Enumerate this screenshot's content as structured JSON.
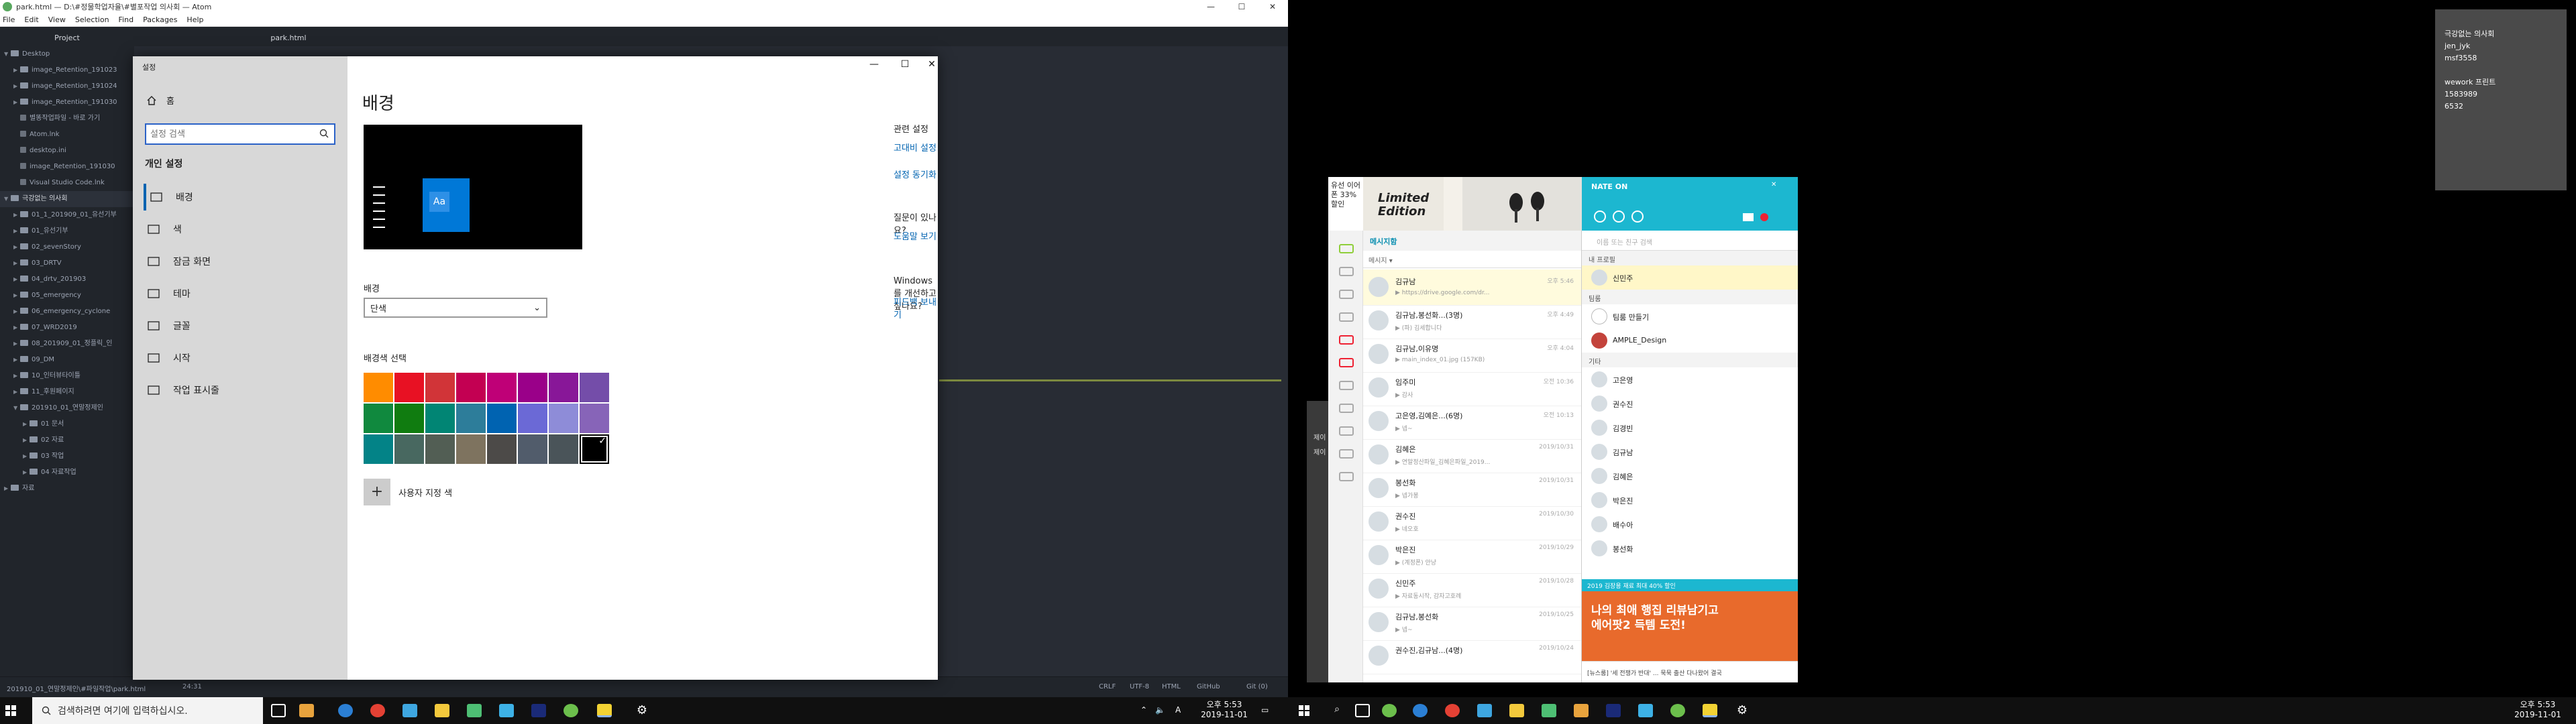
{
  "atom": {
    "window_title": "park.html — D:\\#정물학업자율\\#별포작업 의사회 — Atom",
    "menu": [
      "File",
      "Edit",
      "View",
      "Selection",
      "Find",
      "Packages",
      "Help"
    ],
    "tabs": {
      "project": "Project",
      "file": "park.html"
    },
    "tree": [
      {
        "label": "Desktop",
        "type": "folder",
        "indent": 0,
        "open": true
      },
      {
        "label": "image_Retention_191023",
        "type": "folder",
        "indent": 1
      },
      {
        "label": "image_Retention_191024",
        "type": "folder",
        "indent": 1
      },
      {
        "label": "image_Retention_191030",
        "type": "folder",
        "indent": 1
      },
      {
        "label": "별똥작업파일 - 바로 가기",
        "type": "file",
        "indent": 1
      },
      {
        "label": "Atom.lnk",
        "type": "file",
        "indent": 1
      },
      {
        "label": "desktop.ini",
        "type": "file",
        "indent": 1
      },
      {
        "label": "image_Retention_191030",
        "type": "file",
        "indent": 1
      },
      {
        "label": "Visual Studio Code.lnk",
        "type": "file",
        "indent": 1
      },
      {
        "label": "극강없는 의사회",
        "type": "folder",
        "indent": 0,
        "open": true,
        "selected": true
      },
      {
        "label": "01_1_201909_01_유선기부",
        "type": "folder",
        "indent": 1
      },
      {
        "label": "01_유선기부",
        "type": "folder",
        "indent": 1
      },
      {
        "label": "02_sevenStory",
        "type": "folder",
        "indent": 1
      },
      {
        "label": "03_DRTV",
        "type": "folder",
        "indent": 1
      },
      {
        "label": "04_drtv_201903",
        "type": "folder",
        "indent": 1
      },
      {
        "label": "05_emergency",
        "type": "folder",
        "indent": 1
      },
      {
        "label": "06_emergency_cyclone",
        "type": "folder",
        "indent": 1
      },
      {
        "label": "07_WRD2019",
        "type": "folder",
        "indent": 1
      },
      {
        "label": "08_201909_01_정플릭_인",
        "type": "folder",
        "indent": 1
      },
      {
        "label": "09_DM",
        "type": "folder",
        "indent": 1
      },
      {
        "label": "10_인터뷰타이틀",
        "type": "folder",
        "indent": 1
      },
      {
        "label": "11_후원페이지",
        "type": "folder",
        "indent": 1
      },
      {
        "label": "201910_01_연말정제인",
        "type": "folder",
        "indent": 1,
        "open": true
      },
      {
        "label": "01 문서",
        "type": "folder",
        "indent": 2
      },
      {
        "label": "02 자료",
        "type": "folder",
        "indent": 2
      },
      {
        "label": "03 작업",
        "type": "folder",
        "indent": 2
      },
      {
        "label": "04 자료작업",
        "type": "folder",
        "indent": 2
      },
      {
        "label": "자료",
        "type": "folder",
        "indent": 0
      }
    ],
    "status": {
      "path": "201910_01_연말정제인\\#파일작업\\park.html",
      "cursor": "24:31",
      "line_ending": "CRLF",
      "encoding": "UTF-8",
      "grammar": "HTML",
      "github": "GitHub",
      "git": "Git (0)"
    }
  },
  "settings": {
    "app_label": "설정",
    "home": "홈",
    "search_placeholder": "설정 검색",
    "section": "개인 설정",
    "nav": [
      {
        "label": "배경",
        "icon": "image-icon",
        "active": true
      },
      {
        "label": "색",
        "icon": "palette-icon"
      },
      {
        "label": "잠금 화면",
        "icon": "lock-screen-icon"
      },
      {
        "label": "테마",
        "icon": "brush-icon"
      },
      {
        "label": "글꼴",
        "icon": "font-icon"
      },
      {
        "label": "시작",
        "icon": "start-icon"
      },
      {
        "label": "작업 표시줄",
        "icon": "taskbar-icon"
      }
    ],
    "page_title": "배경",
    "preview_text": "Aa",
    "background_label": "배경",
    "background_value": "단색",
    "accent_label": "배경색 선택",
    "swatches": [
      "#ff8c00",
      "#e81123",
      "#d13438",
      "#c30052",
      "#bf0077",
      "#9a0089",
      "#881798",
      "#744da9",
      "#10893e",
      "#107c10",
      "#018574",
      "#2d7d9a",
      "#0063b1",
      "#6b69d6",
      "#8e8cd8",
      "#8764b8",
      "#038387",
      "#486860",
      "#525e54",
      "#7e735f",
      "#4c4a48",
      "#515c6b",
      "#4a5459",
      "#000000"
    ],
    "selected_swatch": 23,
    "custom_color": "사용자 지정 색",
    "related": {
      "heading": "관련 설정",
      "links": [
        "고대비 설정",
        "설정 동기화"
      ],
      "question_heading": "질문이 있나요?",
      "question_link": "도움말 보기",
      "improve_heading": "Windows를 개선하고 싶나요?",
      "improve_link": "피드백 보내기"
    }
  },
  "second_monitor": {
    "grey_pane": [
      "제이",
      "제이"
    ],
    "note": [
      "극강없는 의사회",
      "jen_jyk",
      "msf3558",
      "",
      "wework 프린트",
      "1583989",
      "6532"
    ]
  },
  "nateon": {
    "ad": {
      "side": "유선 이어폰 33% 할인",
      "title1": "Limited",
      "title2": "Edition"
    },
    "header_brand": "NATE ON",
    "chat_heading": "메시지함",
    "chat_filter": "메시지 ▾",
    "chats": [
      {
        "name": "김규남",
        "preview": "▶ https://drive.google.com/dr...",
        "time": "오후 5:46",
        "selected": true
      },
      {
        "name": "김규남,봉선화...(3명)",
        "preview": "▶ (파) 김세합니다",
        "time": "오후 4:49"
      },
      {
        "name": "김규남,이유명",
        "preview": "▶ main_index_01.jpg (157KB)",
        "time": "오후 4:04"
      },
      {
        "name": "임주미",
        "preview": "▶ 감사",
        "time": "오전 10:36"
      },
      {
        "name": "고은영,김예은...(6명)",
        "preview": "▶ 넵~",
        "time": "오전 10:13"
      },
      {
        "name": "김혜은",
        "preview": "▶ 연말정산파일_김혜은파일_2019...",
        "time": "2019/10/31"
      },
      {
        "name": "봉선화",
        "preview": "▶ 넵가봉",
        "time": "2019/10/31"
      },
      {
        "name": "권수진",
        "preview": "▶ 네오호",
        "time": "2019/10/30"
      },
      {
        "name": "박은진",
        "preview": "▶ (계정폰) 안냥",
        "time": "2019/10/29"
      },
      {
        "name": "신민주",
        "preview": "▶ 자료동시작, 감자고호례",
        "time": "2019/10/28"
      },
      {
        "name": "김규남,봉선화",
        "preview": "▶ 넵~",
        "time": "2019/10/25"
      },
      {
        "name": "권수진,김규남...(4명)",
        "preview": "",
        "time": "2019/10/24"
      }
    ],
    "friend_search": "이름 또는 친구 검색",
    "sections": [
      "내 프로필",
      "팀룸",
      "기타"
    ],
    "friends": {
      "profile": [
        {
          "name": "신민주",
          "selected": true
        }
      ],
      "team": [
        "팀룸 만들기",
        "AMPLE_Design"
      ],
      "others": [
        "고은영",
        "권수진",
        "김경빈",
        "김규남",
        "김혜은",
        "박은진",
        "배수아",
        "봉선화"
      ]
    },
    "ad_strip": "2019 김장용 재료 최대 40% 할인",
    "ad_bottom": [
      "나의 최애 행집 리뷰남기고",
      "에어팟2 득템 도전!"
    ],
    "news": "[뉴스룸] '세 전쟁가 반대' ... 묵묵 출산 다나왔어 결국"
  },
  "taskbar": {
    "search_placeholder": "검색하려면 여기에 입력하십시오.",
    "left_clock": {
      "time": "오후 5:53",
      "date": "2019-11-01"
    },
    "right_clock": {
      "time": "오후 5:53",
      "date": "2019-11-01"
    },
    "ime": "A"
  }
}
